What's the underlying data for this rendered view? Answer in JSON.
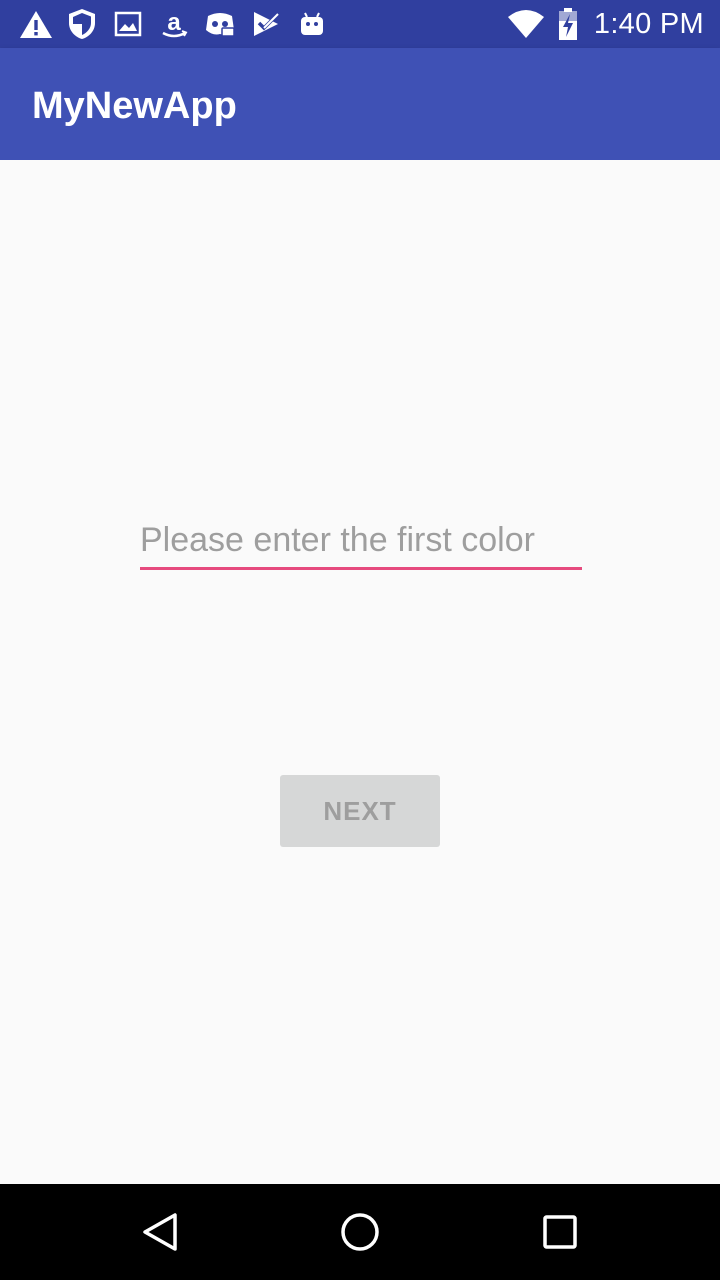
{
  "status_bar": {
    "time": "1:40 PM",
    "left_icons": [
      "warning-icon",
      "shield-icon",
      "image-icon",
      "amazon-icon",
      "discord-icon",
      "check-app-icon",
      "android-icon"
    ],
    "right_icons": [
      "wifi-icon",
      "battery-charging-icon"
    ],
    "background": "#303F9F"
  },
  "app_bar": {
    "title": "MyNewApp",
    "background": "#3F51B5"
  },
  "form": {
    "color_input_placeholder": "Please enter the first color",
    "color_input_value": "",
    "next_label": "NEXT",
    "accent": "#E64A7E"
  },
  "nav_bar": {
    "icons": [
      "back-icon",
      "home-icon",
      "recents-icon"
    ]
  }
}
